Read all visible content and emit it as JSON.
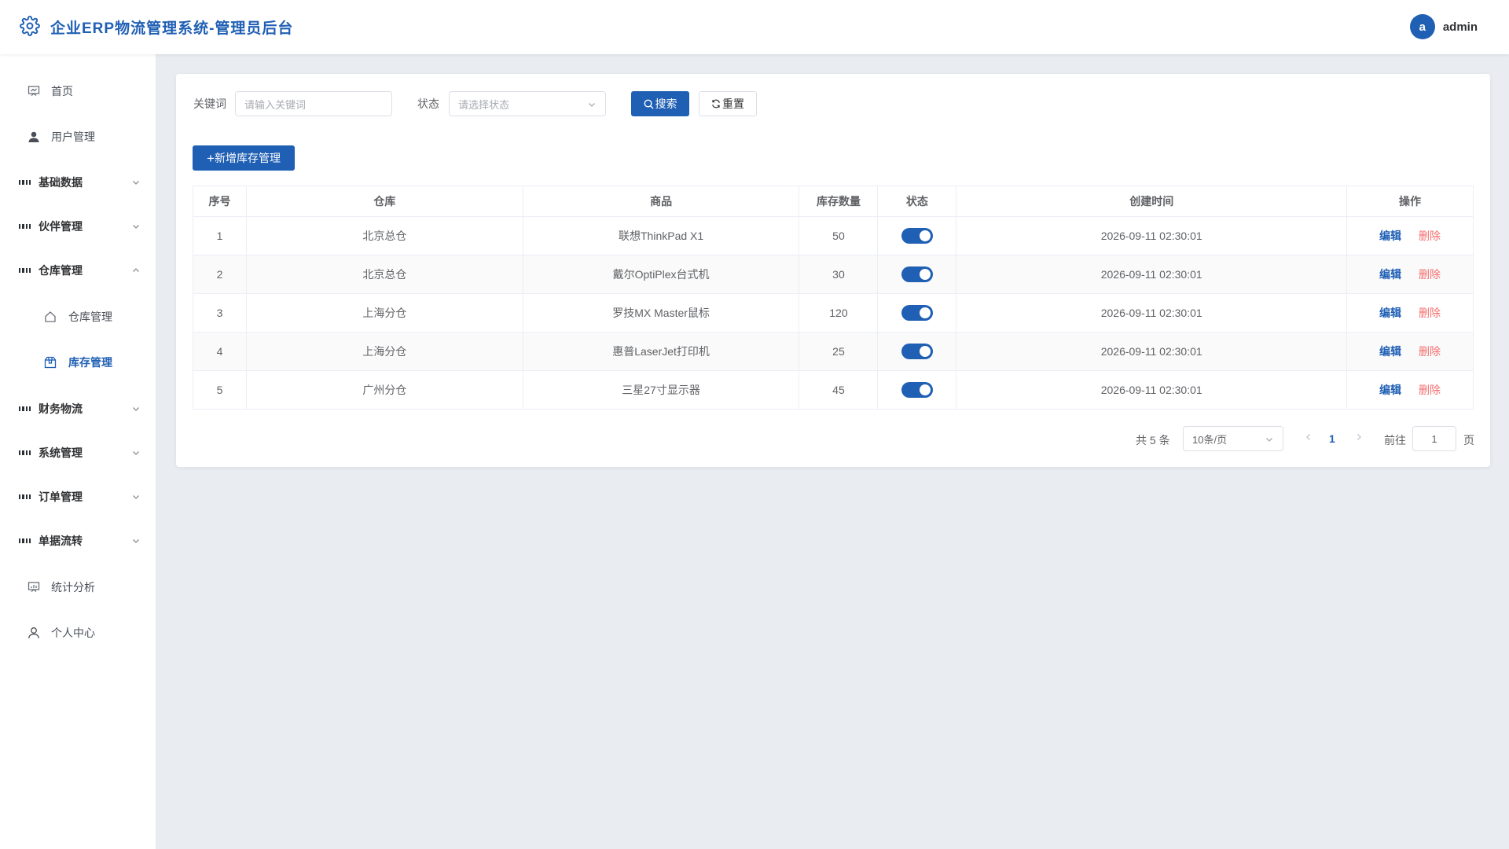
{
  "app": {
    "title": "企业ERP物流管理系统-管理员后台",
    "user_initial": "a",
    "user_name": "admin",
    "accent_color": "#1f5fb4"
  },
  "sidebar": {
    "items": [
      {
        "label": "首页",
        "icon": "dashboard-icon",
        "kind": "top"
      },
      {
        "label": "用户管理",
        "icon": "user-icon",
        "kind": "top"
      },
      {
        "label": "基础数据",
        "icon": "grid-icon",
        "kind": "group",
        "expanded": false
      },
      {
        "label": "伙伴管理",
        "icon": "grid-icon",
        "kind": "group",
        "expanded": false
      },
      {
        "label": "仓库管理",
        "icon": "grid-icon",
        "kind": "group",
        "expanded": true
      },
      {
        "label": "仓库管理",
        "icon": "house-icon",
        "kind": "sub"
      },
      {
        "label": "库存管理",
        "icon": "box-icon",
        "kind": "sub",
        "active": true
      },
      {
        "label": "财务物流",
        "icon": "grid-icon",
        "kind": "group",
        "expanded": false
      },
      {
        "label": "系统管理",
        "icon": "grid-icon",
        "kind": "group",
        "expanded": false
      },
      {
        "label": "订单管理",
        "icon": "grid-icon",
        "kind": "group",
        "expanded": false
      },
      {
        "label": "单据流转",
        "icon": "grid-icon",
        "kind": "group",
        "expanded": false
      },
      {
        "label": "统计分析",
        "icon": "chart-board-icon",
        "kind": "top"
      },
      {
        "label": "个人中心",
        "icon": "person-icon",
        "kind": "top"
      }
    ]
  },
  "search": {
    "keyword_label": "关键词",
    "keyword_placeholder": "请输入关键词",
    "keyword_value": "",
    "status_label": "状态",
    "status_placeholder": "请选择状态",
    "search_button": "搜索",
    "reset_button": "重置"
  },
  "toolbar": {
    "add_button": "新增库存管理"
  },
  "table": {
    "columns": [
      "序号",
      "仓库",
      "商品",
      "库存数量",
      "状态",
      "创建时间",
      "操作"
    ],
    "rows": [
      {
        "index": "1",
        "warehouse": "北京总仓",
        "product": "联想ThinkPad X1",
        "quantity": "50",
        "status_on": true,
        "created": "2026-09-11 02:30:01"
      },
      {
        "index": "2",
        "warehouse": "北京总仓",
        "product": "戴尔OptiPlex台式机",
        "quantity": "30",
        "status_on": true,
        "created": "2026-09-11 02:30:01"
      },
      {
        "index": "3",
        "warehouse": "上海分仓",
        "product": "罗技MX Master鼠标",
        "quantity": "120",
        "status_on": true,
        "created": "2026-09-11 02:30:01"
      },
      {
        "index": "4",
        "warehouse": "上海分仓",
        "product": "惠普LaserJet打印机",
        "quantity": "25",
        "status_on": true,
        "created": "2026-09-11 02:30:01"
      },
      {
        "index": "5",
        "warehouse": "广州分仓",
        "product": "三星27寸显示器",
        "quantity": "45",
        "status_on": true,
        "created": "2026-09-11 02:30:01"
      }
    ],
    "edit_label": "编辑",
    "delete_label": "删除"
  },
  "pagination": {
    "total_text": "共 5 条",
    "page_size": "10条/页",
    "current_page": "1",
    "goto_label": "前往",
    "goto_value": "1",
    "page_suffix": "页"
  }
}
